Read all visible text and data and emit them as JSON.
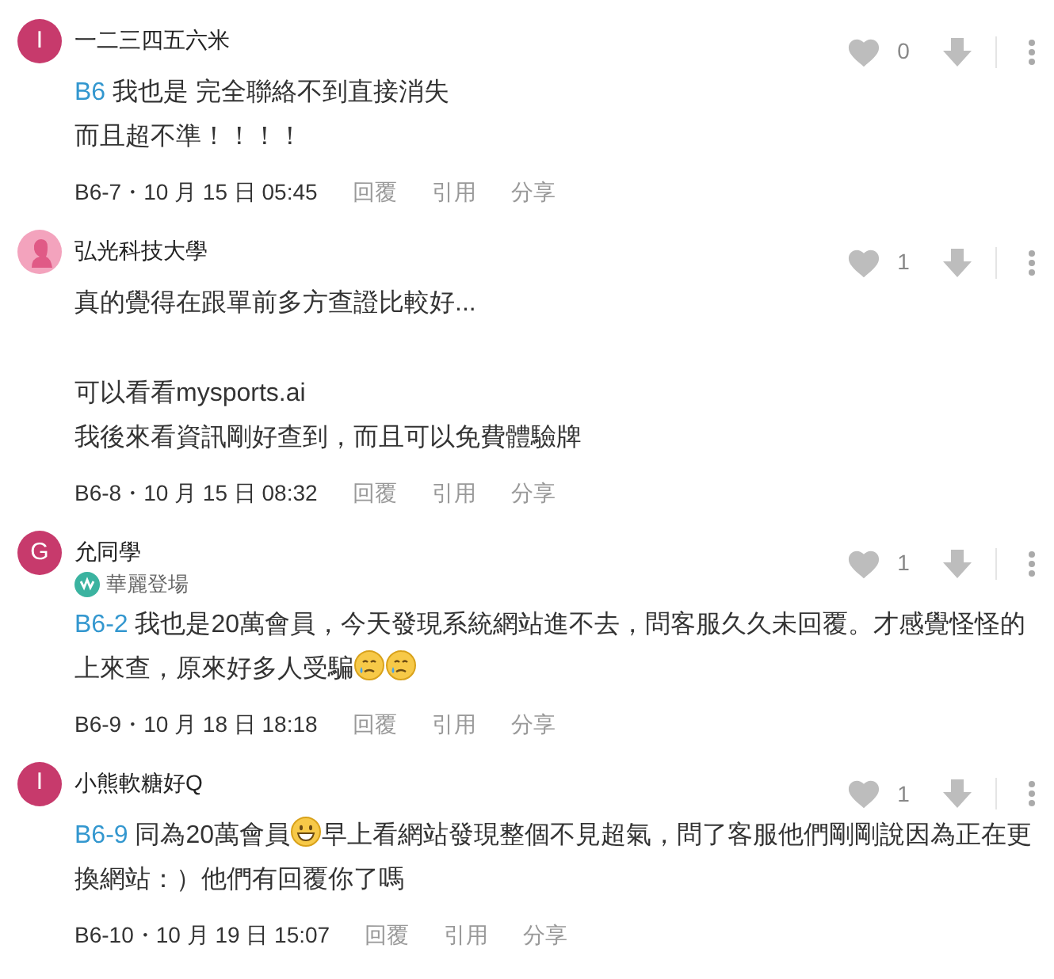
{
  "comments": [
    {
      "avatar": {
        "kind": "letter",
        "letter": "I",
        "color": "#c73a6c"
      },
      "name": "一二三四五六米",
      "likes": "0",
      "paragraphs": [
        [
          [
            {
              "kind": "ref",
              "text": "B6"
            },
            {
              "kind": "text",
              "text": " 我也是 完全聯絡不到直接消失"
            }
          ],
          [
            {
              "kind": "text",
              "text": "而且超不準！！！！"
            }
          ]
        ]
      ],
      "meta": "B6-7・10 月 15 日 05:45",
      "actions": [
        "回覆",
        "引用",
        "分享"
      ]
    },
    {
      "avatar": {
        "kind": "silhouette",
        "color": "#f3a3bd"
      },
      "name": "弘光科技大學",
      "likes": "1",
      "paragraphs": [
        [
          [
            {
              "kind": "text",
              "text": "真的覺得在跟單前多方查證比較好..."
            }
          ]
        ],
        [
          [
            {
              "kind": "text",
              "text": "可以看看mysports.ai"
            }
          ],
          [
            {
              "kind": "text",
              "text": "我後來看資訊剛好查到，而且可以免費體驗牌"
            }
          ]
        ]
      ],
      "meta": "B6-8・10 月 15 日 08:32",
      "actions": [
        "回覆",
        "引用",
        "分享"
      ]
    },
    {
      "avatar": {
        "kind": "letter",
        "letter": "G",
        "color": "#c73a6c"
      },
      "name": "允同學",
      "badge": "華麗登場",
      "likes": "1",
      "paragraphs": [
        [
          [
            {
              "kind": "ref",
              "text": "B6-2"
            },
            {
              "kind": "text",
              "text": " 我也是20萬會員，今天發現系統網站進不去，問客服久久未回覆。才感覺怪怪的"
            }
          ],
          [
            {
              "kind": "text",
              "text": "上來查，原來好多人受騙"
            },
            {
              "kind": "tear_emoji"
            },
            {
              "kind": "tear_emoji"
            }
          ]
        ]
      ],
      "meta": "B6-9・10 月 18 日 18:18",
      "actions": [
        "回覆",
        "引用",
        "分享"
      ]
    },
    {
      "avatar": {
        "kind": "letter",
        "letter": "I",
        "color": "#c73a6c"
      },
      "name": "小熊軟糖好Q",
      "likes": "1",
      "paragraphs": [
        [
          [
            {
              "kind": "ref",
              "text": "B6-9"
            },
            {
              "kind": "text",
              "text": " 同為20萬會員"
            },
            {
              "kind": "grin_emoji"
            },
            {
              "kind": "text",
              "text": "早上看網站發現整個不見超氣，問了客服他們剛剛說因為正在更"
            }
          ],
          [
            {
              "kind": "text",
              "text": "換網站：）他們有回覆你了嗎"
            }
          ]
        ]
      ],
      "meta": "B6-10・10 月 19 日 15:07",
      "actions": [
        "回覆",
        "引用",
        "分享"
      ]
    }
  ]
}
